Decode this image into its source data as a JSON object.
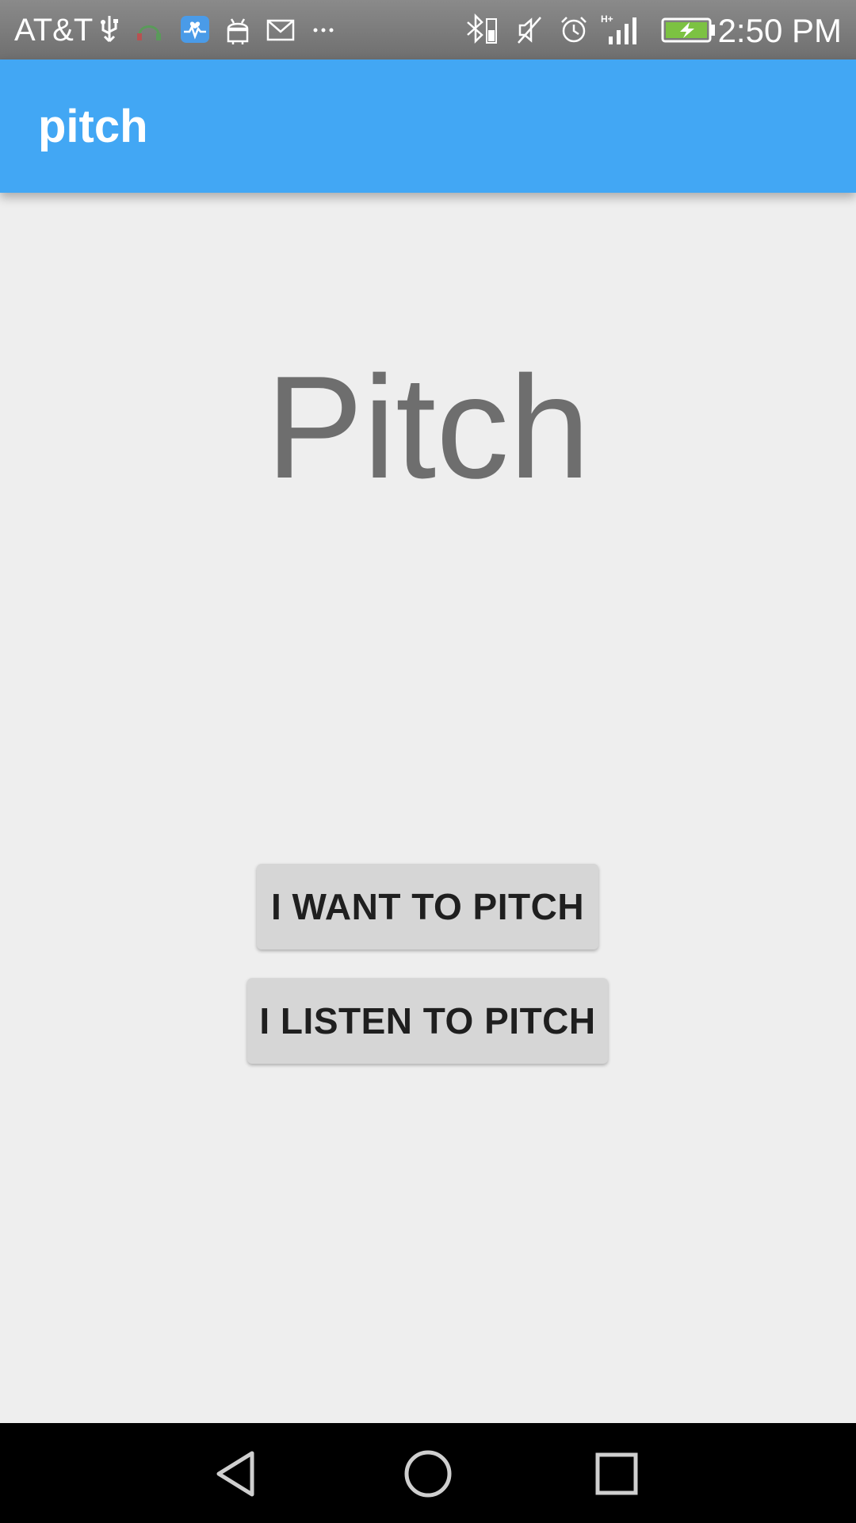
{
  "status_bar": {
    "carrier": "AT&T",
    "time": "2:50 PM",
    "icons": [
      "usb-icon",
      "headset-icon",
      "health-app-icon",
      "android-icon",
      "email-icon",
      "more-notifications-icon",
      "bluetooth-icon",
      "mute-icon",
      "alarm-icon",
      "signal-icon",
      "battery-charging-icon"
    ]
  },
  "app_bar": {
    "title": "pitch",
    "color": "#42a7f4"
  },
  "main": {
    "hero_title": "Pitch",
    "buttons": [
      {
        "label": "I WANT TO PITCH"
      },
      {
        "label": "I LISTEN TO PITCH"
      }
    ]
  },
  "nav_bar": {
    "buttons": [
      "back-icon",
      "home-icon",
      "recents-icon"
    ]
  }
}
